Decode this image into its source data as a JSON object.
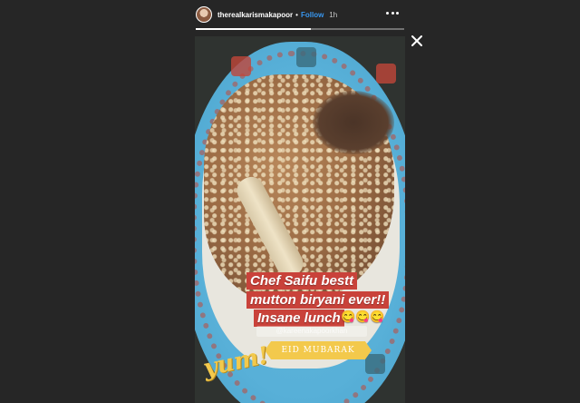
{
  "story": {
    "username": "therealkarismakapoor",
    "separator": "•",
    "follow_label": "Follow",
    "time_ago": "1h",
    "progress_fraction": 0.55
  },
  "stickers": {
    "line1": "Chef Saifu bestt",
    "line2": "mutton biryani ever!!",
    "line3": "Insane lunch",
    "emojis": "😋😋😋",
    "mention": "@kareenakapoorkhan",
    "eid": "EID MUBARAK",
    "yum": "yum!"
  },
  "icons": {
    "more": "more-options-icon",
    "close": "close-icon"
  },
  "colors": {
    "background": "#262626",
    "follow_blue": "#3897f0",
    "sticker_red": "#c9423a",
    "eid_yellow": "#f3c94c"
  }
}
